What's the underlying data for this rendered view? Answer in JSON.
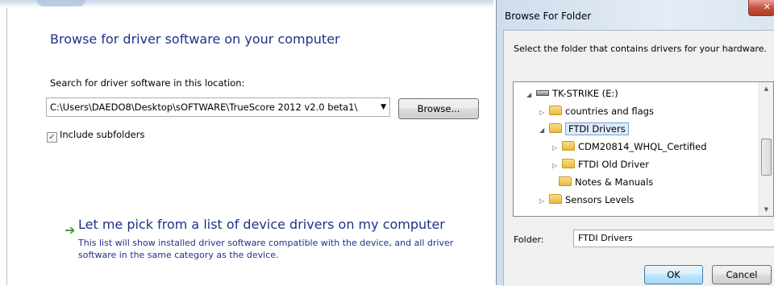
{
  "wizard": {
    "title": "Browse for driver software on your computer",
    "search_label": "Search for driver software in this location:",
    "path_value": "C:\\Users\\DAEDO8\\Desktop\\sOFTWARE\\TrueScore 2012 v2.0 beta1\\",
    "browse_label": "Browse...",
    "include_subfolders_label": "Include subfolders",
    "include_subfolders_checked": true,
    "pick_title": "Let me pick from a list of device drivers on my computer",
    "pick_description": "This list will show installed driver software compatible with the device, and all driver software in the same category as the device."
  },
  "dialog": {
    "title": "Browse For Folder",
    "message": "Select the folder that contains drivers for your hardware.",
    "tree": [
      {
        "label": "TK-STRIKE (E:)",
        "type": "drive",
        "expanded": true
      },
      {
        "label": "countries and flags",
        "type": "folder",
        "expanded": false
      },
      {
        "label": "FTDI Drivers",
        "type": "folder",
        "expanded": true,
        "selected": true
      },
      {
        "label": "CDM20814_WHQL_Certified",
        "type": "folder",
        "expanded": false
      },
      {
        "label": "FTDI Old Driver",
        "type": "folder",
        "expanded": false
      },
      {
        "label": "Notes & Manuals",
        "type": "folder"
      },
      {
        "label": "Sensors Levels",
        "type": "folder",
        "expanded": false
      }
    ],
    "folder_label": "Folder:",
    "folder_value": "FTDI Drivers",
    "ok_label": "OK",
    "cancel_label": "Cancel"
  },
  "colors": {
    "heading": "#1e3287",
    "accent_green": "#3d9b2e",
    "selection": "#dcebfc"
  }
}
